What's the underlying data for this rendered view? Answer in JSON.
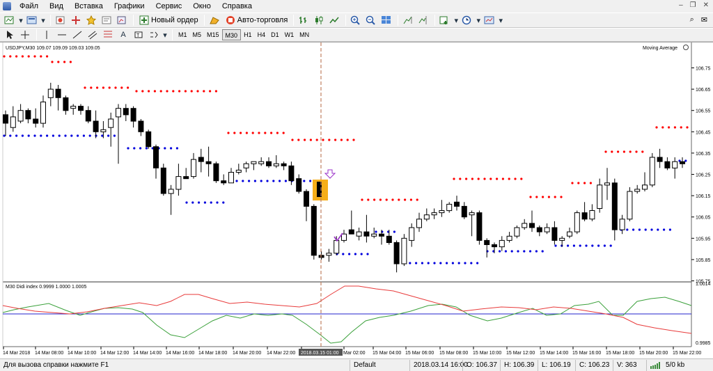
{
  "menu": [
    "Файл",
    "Вид",
    "Вставка",
    "Графики",
    "Сервис",
    "Окно",
    "Справка"
  ],
  "toolbar": {
    "new_order": "Новый ордер",
    "auto_trading": "Авто-торговля"
  },
  "timeframes": [
    "M1",
    "M5",
    "M15",
    "M30",
    "H1",
    "H4",
    "D1",
    "W1",
    "MN"
  ],
  "active_timeframe": "M30",
  "chart": {
    "header": "USDJPY,M30  109.07 109.09 109.03 109.05",
    "indicator_label": "Moving Average",
    "sub_label": "M30 Didi index 0.9999 1.0000 1.0005",
    "price_ticks": [
      "106.75",
      "106.55",
      "106.35",
      "106.15",
      "105.95",
      "105.75",
      "106.65",
      "106.45",
      "106.25",
      "106.05",
      "105.85"
    ],
    "sub_ticks": [
      "1.0014",
      "0.9985"
    ],
    "time_labels": [
      "14 Mar 2018",
      "14 Mar 08:00",
      "14 Mar 10:00",
      "14 Mar 12:00",
      "14 Mar 14:00",
      "14 Mar 16:00",
      "14 Mar 18:00",
      "14 Mar 20:00",
      "14 Mar 22:00",
      "2018.03.15 01:00",
      "Mar 02:00",
      "15 Mar 04:00",
      "15 Mar 06:00",
      "15 Mar 08:00",
      "15 Mar 10:00",
      "15 Mar 12:00",
      "15 Mar 14:00",
      "15 Mar 16:00",
      "15 Mar 18:00",
      "15 Mar 20:00",
      "15 Mar 22:00"
    ],
    "highlight_time_index": 9,
    "colors": {
      "up_dot": "#ff0000",
      "down_dot": "#0000dd",
      "candle": "#000000",
      "highlight": "#f5a500",
      "arrow": "#9a30c8",
      "green_line": "#3aa03a",
      "red_line": "#e83a3a",
      "blue_line": "#2222cc",
      "crosshair": "#c08060"
    }
  },
  "status": {
    "help": "Для вызова справки нажмите F1",
    "profile": "Default",
    "datetime": "2018.03.14 16:00",
    "open": "O: 106.37",
    "high": "H: 106.39",
    "low": "L: 106.19",
    "close": "C: 106.23",
    "volume": "V: 363",
    "traffic": "5/0 kb"
  }
}
